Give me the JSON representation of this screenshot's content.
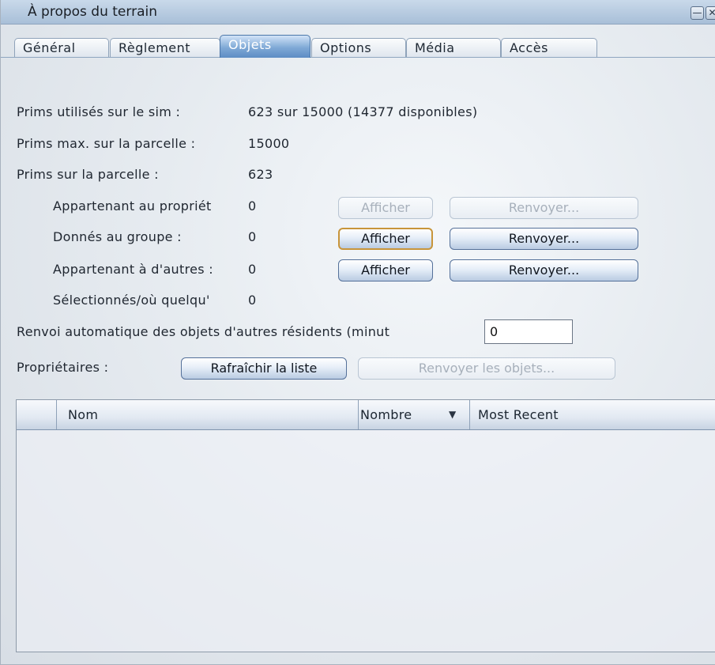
{
  "window": {
    "title": "À propos du terrain"
  },
  "titlebar_buttons": {
    "minimize": "—",
    "close": "✕"
  },
  "tabs": [
    {
      "label": "Général"
    },
    {
      "label": "Règlement"
    },
    {
      "label": "Objets",
      "active": true
    },
    {
      "label": "Options"
    },
    {
      "label": "Média"
    },
    {
      "label": "Accès"
    }
  ],
  "stats": {
    "sim_label": "Prims utilisés sur le sim :",
    "sim_value": "623 sur 15000 (14377 disponibles)",
    "max_label": "Prims max. sur la parcelle :",
    "max_value": "15000",
    "parcel_label": "Prims sur la parcelle :",
    "parcel_value": "623"
  },
  "rows": [
    {
      "label": "Appartenant au propriét",
      "value": "0",
      "show_label": "Afficher",
      "return_label": "Renvoyer...",
      "disabled": true
    },
    {
      "label": "Donnés au groupe :",
      "value": "0",
      "show_label": "Afficher",
      "return_label": "Renvoyer...",
      "disabled": false
    },
    {
      "label": "Appartenant à d'autres :",
      "value": "0",
      "show_label": "Afficher",
      "return_label": "Renvoyer...",
      "disabled": false
    },
    {
      "label": "Sélectionnés/où quelqu'",
      "value": "0"
    }
  ],
  "autoreturn": {
    "label": "Renvoi automatique des objets d'autres résidents (minut",
    "value": "0"
  },
  "owners": {
    "label": "Propriétaires :",
    "refresh_label": "Rafraîchir la liste",
    "return_objects_label": "Renvoyer les objets..."
  },
  "table": {
    "columns": [
      "",
      "Nom",
      "Nombre",
      "Most Recent"
    ],
    "sort_icon": "▼",
    "rows": []
  }
}
